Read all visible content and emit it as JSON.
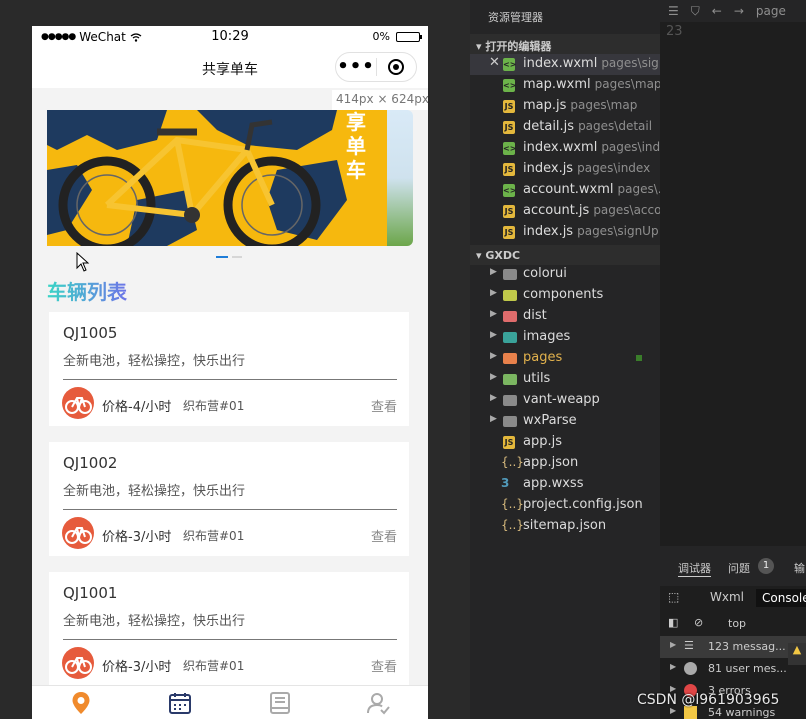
{
  "phone": {
    "status": {
      "carrier": "WeChat",
      "time": "10:29",
      "battery": "0%"
    },
    "nav": {
      "title": "共享单车",
      "more_label": "•••"
    },
    "size_tag": "414px × 624px",
    "banner": {
      "text": "享单车"
    },
    "section_title": "车辆列表",
    "vehicles": [
      {
        "code": "QJ1005",
        "desc": "全新电池，轻松操控，快乐出行",
        "price": "价格-4/小时",
        "owner": "织布营#01",
        "view": "查看"
      },
      {
        "code": "QJ1002",
        "desc": "全新电池，轻松操控，快乐出行",
        "price": "价格-3/小时",
        "owner": "织布营#01",
        "view": "查看"
      },
      {
        "code": "QJ1001",
        "desc": "全新电池，轻松操控，快乐出行",
        "price": "价格-3/小时",
        "owner": "织布营#01",
        "view": "查看"
      }
    ],
    "tabs": [
      "location-pin-icon",
      "calendar-icon",
      "book-icon",
      "user-icon"
    ]
  },
  "ide": {
    "explorer_title": "资源管理器",
    "tab_crumb": "page",
    "line_number": "23",
    "open_editors_label": "打开的编辑器",
    "project_label": "GXDC",
    "open_editors": [
      {
        "name": "index.wxml",
        "path": "pages\\sig...",
        "type": "wxml"
      },
      {
        "name": "map.wxml",
        "path": "pages\\map",
        "type": "wxml"
      },
      {
        "name": "map.js",
        "path": "pages\\map",
        "type": "js"
      },
      {
        "name": "detail.js",
        "path": "pages\\detail",
        "type": "js"
      },
      {
        "name": "index.wxml",
        "path": "pages\\ind...",
        "type": "wxml"
      },
      {
        "name": "index.js",
        "path": "pages\\index",
        "type": "js"
      },
      {
        "name": "account.wxml",
        "path": "pages\\...",
        "type": "wxml"
      },
      {
        "name": "account.js",
        "path": "pages\\acco...",
        "type": "js"
      },
      {
        "name": "index.js",
        "path": "pages\\signUp",
        "type": "js"
      }
    ],
    "folders": [
      {
        "name": "colorui",
        "color": "#8a8a8a"
      },
      {
        "name": "components",
        "color": "#c0c94a"
      },
      {
        "name": "dist",
        "color": "#e06c6c"
      },
      {
        "name": "images",
        "color": "#3aa39a"
      },
      {
        "name": "pages",
        "color": "#e8814b"
      },
      {
        "name": "utils",
        "color": "#7bb661"
      },
      {
        "name": "vant-weapp",
        "color": "#8a8a8a"
      },
      {
        "name": "wxParse",
        "color": "#8a8a8a"
      }
    ],
    "files": [
      {
        "name": "app.js",
        "type": "js"
      },
      {
        "name": "app.json",
        "type": "json"
      },
      {
        "name": "app.wxss",
        "type": "wxss"
      },
      {
        "name": "project.config.json",
        "type": "json"
      },
      {
        "name": "sitemap.json",
        "type": "json"
      }
    ],
    "debug": {
      "tab_debugger": "调试器",
      "tab_issues": "问题",
      "issues_count": "1",
      "tab_output": "输",
      "wxml_label": "Wxml",
      "console_label": "Console",
      "context": "top",
      "rows": [
        {
          "text": "123 messag...",
          "color": "#aaaaaa"
        },
        {
          "text": "81 user mes...",
          "color": "#aaaaaa"
        },
        {
          "text": "3 errors",
          "color": "#e04646"
        },
        {
          "text": "54 warnings",
          "color": "#f2c744"
        }
      ]
    }
  },
  "watermark": "CSDN @l961903965"
}
